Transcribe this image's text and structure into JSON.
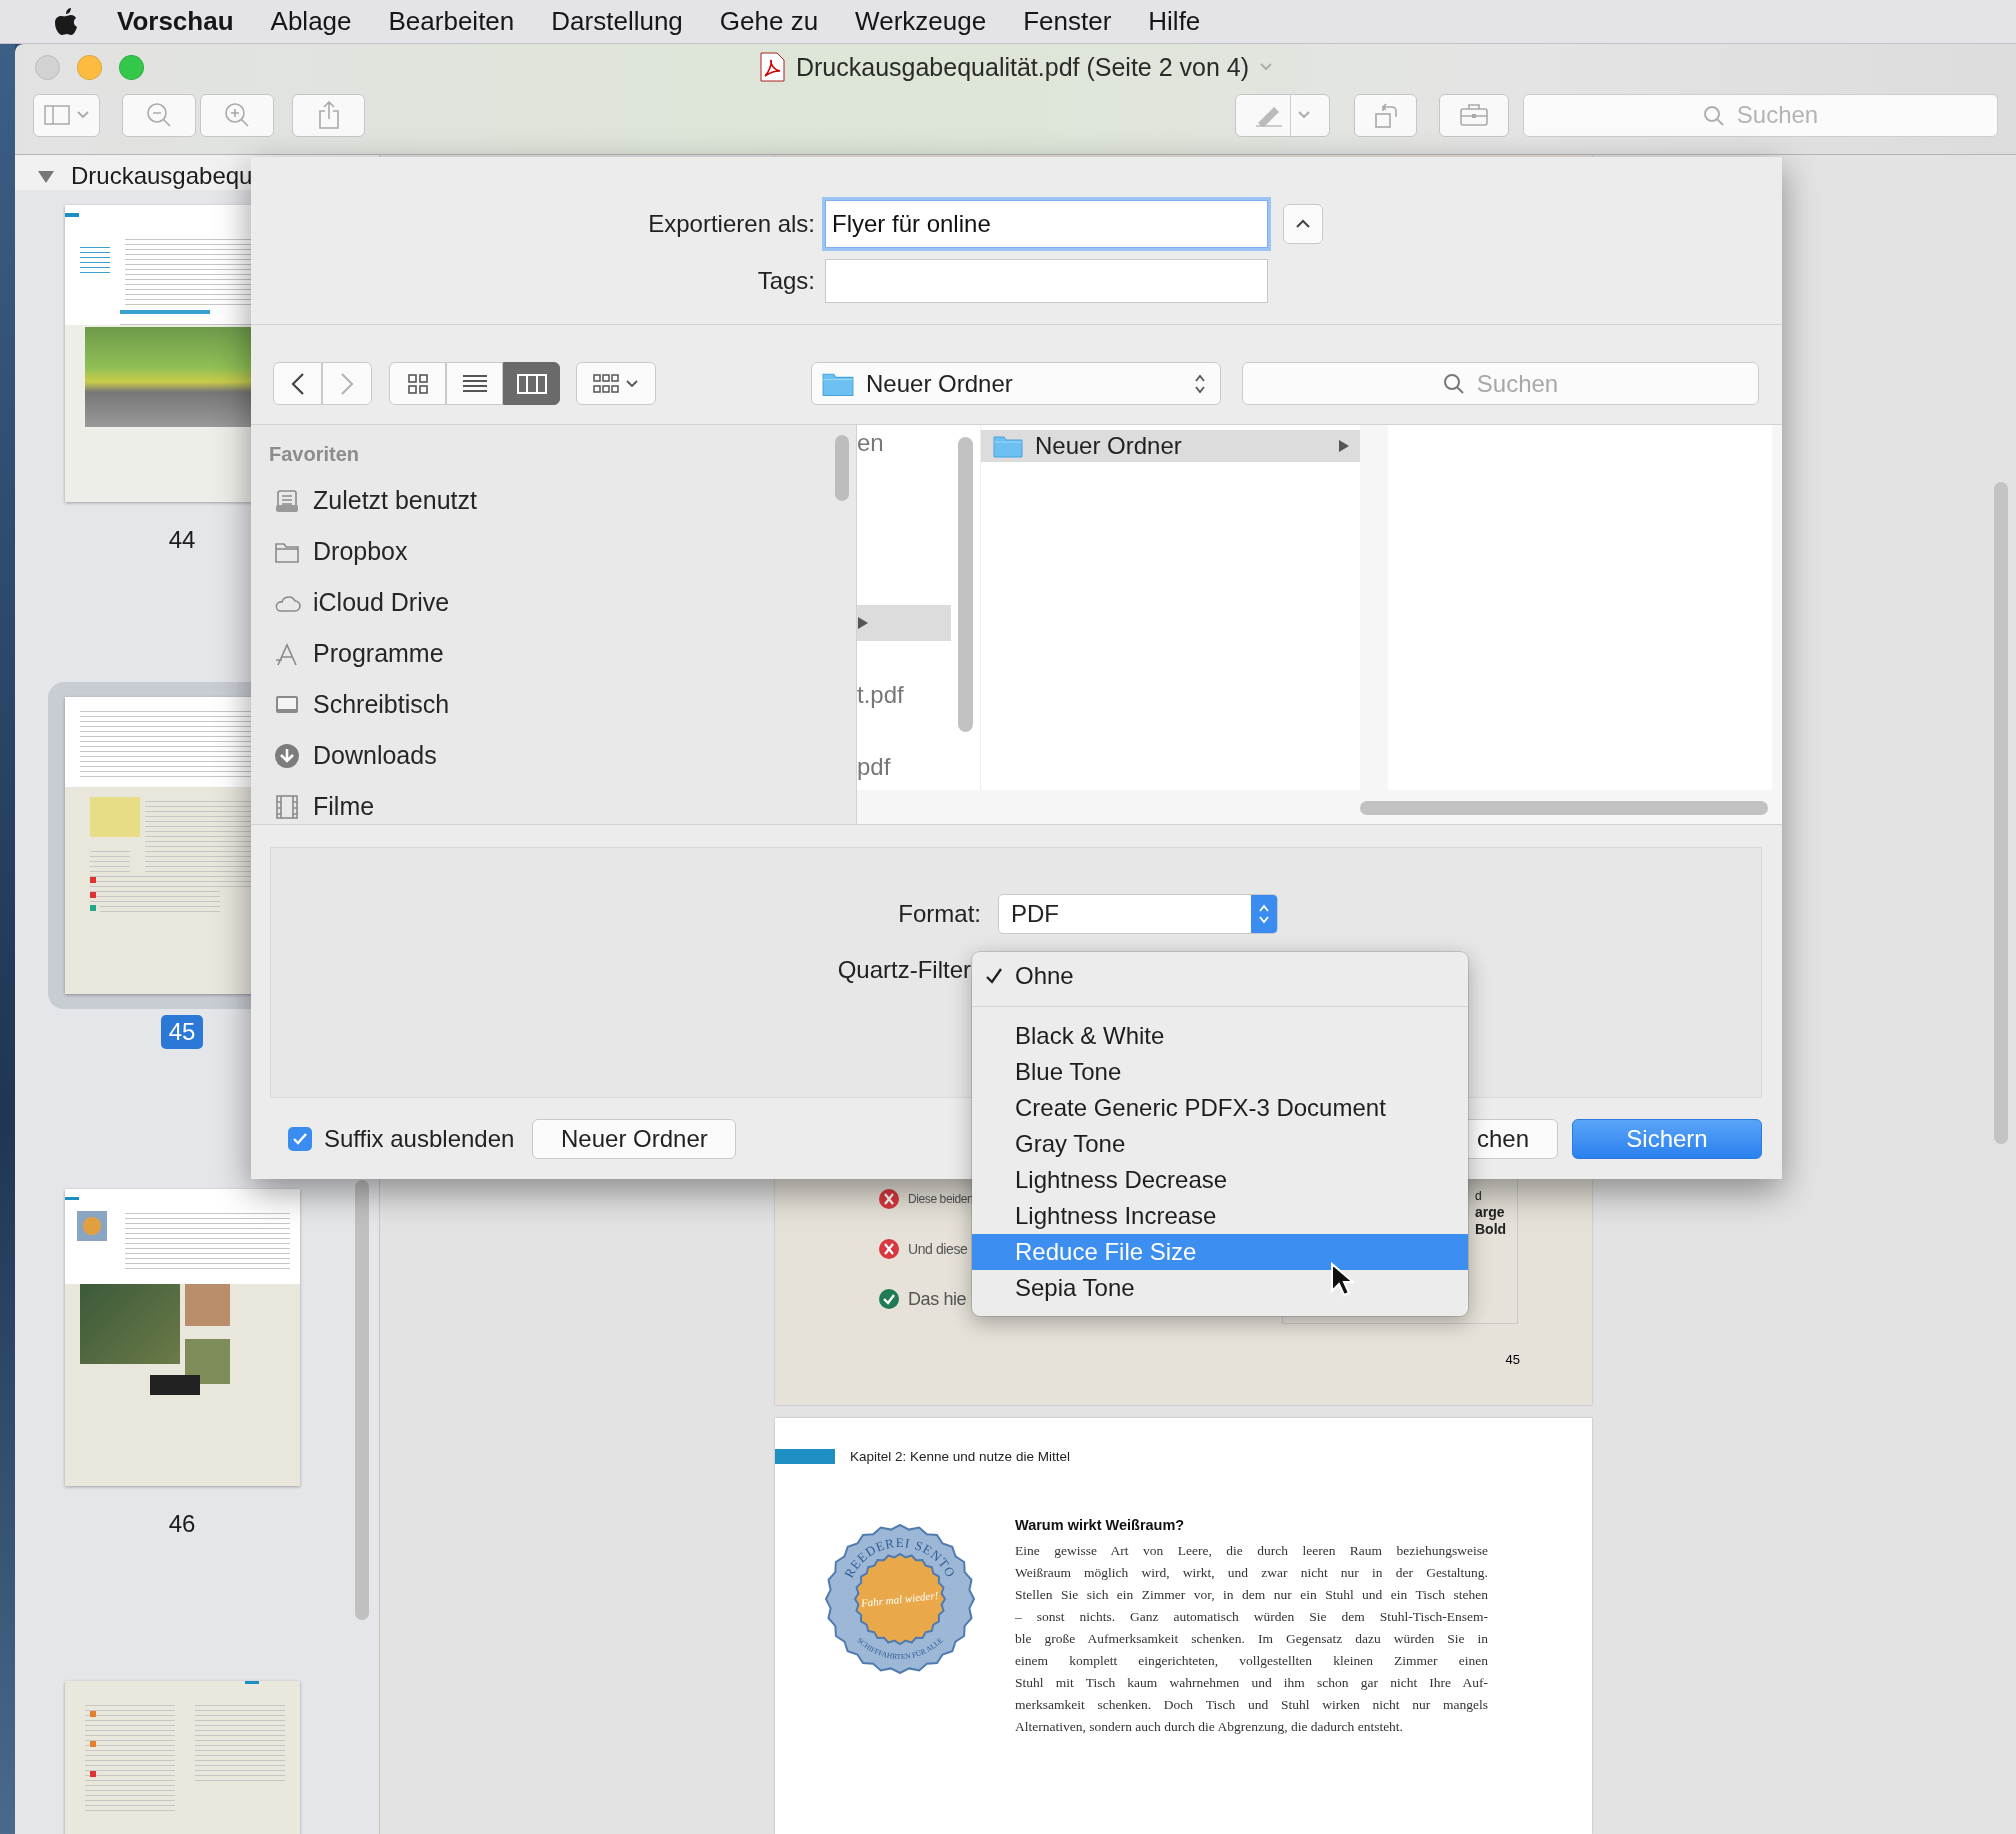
{
  "menubar": {
    "app_name": "Vorschau",
    "items": [
      "Ablage",
      "Bearbeiten",
      "Darstellung",
      "Gehe zu",
      "Werkzeuge",
      "Fenster",
      "Hilfe"
    ]
  },
  "window": {
    "title": "Druckausgabequalität.pdf (Seite 2 von 4)",
    "search_placeholder": "Suchen",
    "buttons": [
      {
        "kind": "close",
        "disabled": true
      },
      {
        "kind": "minimize",
        "disabled": false
      },
      {
        "kind": "zoom",
        "disabled": false
      }
    ]
  },
  "sidebar": {
    "title": "Druckausgabequ",
    "thumbnails": [
      {
        "kind": "text-photo",
        "label": "44",
        "selected": false
      },
      {
        "kind": "text-boxes",
        "label": "45",
        "selected": true
      },
      {
        "kind": "photos",
        "label": "46",
        "selected": false
      },
      {
        "kind": "list",
        "selected": false
      }
    ]
  },
  "document": {
    "page_45": {
      "notes": [
        {
          "kind": "cross",
          "text": "Diese beiden"
        },
        {
          "kind": "cross",
          "text": "Und diese"
        },
        {
          "kind": "check",
          "text": "Das hie"
        }
      ],
      "box_lines": [
        "d",
        "arge",
        "Bold"
      ],
      "page_number": "45"
    },
    "page_46": {
      "header": "Kapitel 2: Kenne und nutze die Mittel",
      "badge": {
        "top": "REEDEREI SENTO",
        "middle": "Fahr mal wieder!",
        "bottom": "SCHIFFFAHRTEN FÜR ALLE"
      },
      "heading": "Warum wirkt Weißraum?",
      "lines": [
        "Eine gewisse Art von Leere, die durch leeren Raum beziehungsweise",
        "Weißraum möglich wird, wirkt, und zwar nicht nur in der Gestaltung.",
        "Stellen Sie sich ein Zimmer vor, in dem nur ein Stuhl und ein Tisch stehen",
        "– sonst nichts. Ganz automatisch würden Sie dem Stuhl-Tisch-Ensem-",
        "ble große Aufmerksamkeit schenken. Im Gegensatz dazu würden Sie in",
        "einem komplett eingerichteten, vollgestellten kleinen Zimmer einen",
        "Stuhl mit Tisch kaum wahrnehmen und ihm schon gar nicht Ihre Auf-",
        "merksamkeit schenken. Doch Tisch und Stuhl wirken nicht nur mangels",
        "Alternativen, sondern auch durch die Abgrenzung, die dadurch entsteht."
      ]
    }
  },
  "dialog": {
    "export_label": "Exportieren als:",
    "filename": "Flyer für online",
    "tags_label": "Tags:",
    "view_modes": [
      {
        "kind": "icons",
        "selected": false
      },
      {
        "kind": "list",
        "selected": false
      },
      {
        "kind": "columns",
        "selected": true
      }
    ],
    "location": "Neuer Ordner",
    "search_placeholder": "Suchen",
    "favorites_heading": "Favoriten",
    "favorites": [
      {
        "kind": "recents",
        "label": "Zuletzt benutzt"
      },
      {
        "kind": "folder",
        "label": "Dropbox"
      },
      {
        "kind": "cloud",
        "label": "iCloud Drive"
      },
      {
        "kind": "apps",
        "label": "Programme"
      },
      {
        "kind": "desktop",
        "label": "Schreibtisch"
      },
      {
        "kind": "downloads",
        "label": "Downloads"
      },
      {
        "kind": "film",
        "label": "Filme"
      }
    ],
    "column_1": [
      {
        "label": "en",
        "selected": false
      },
      {
        "selected": true
      },
      {
        "label": "t.pdf",
        "selected": false
      },
      {
        "label": "pdf",
        "selected": false
      }
    ],
    "column_2": [
      {
        "label": "Neuer Ordner",
        "selected": true
      }
    ],
    "format_label": "Format:",
    "format_value": "PDF",
    "quartz_label": "Quartz-Filter",
    "quartz_menu": [
      {
        "kind": "option",
        "label": "Ohne",
        "checked": true,
        "selected": false
      },
      {
        "kind": "separator"
      },
      {
        "kind": "option",
        "label": "Black & White",
        "checked": false,
        "selected": false
      },
      {
        "kind": "option",
        "label": "Blue Tone",
        "checked": false,
        "selected": false
      },
      {
        "kind": "option",
        "label": "Create Generic PDFX-3 Document",
        "checked": false,
        "selected": false
      },
      {
        "kind": "option",
        "label": "Gray Tone",
        "checked": false,
        "selected": false
      },
      {
        "kind": "option",
        "label": "Lightness Decrease",
        "checked": false,
        "selected": false
      },
      {
        "kind": "option",
        "label": "Lightness Increase",
        "checked": false,
        "selected": false
      },
      {
        "kind": "option",
        "label": "Reduce File Size",
        "checked": false,
        "selected": true
      },
      {
        "kind": "option",
        "label": "Sepia Tone",
        "checked": false,
        "selected": false
      }
    ],
    "suffix": {
      "label": "Suffix ausblenden",
      "checked": true
    },
    "new_folder_button": "Neuer Ordner",
    "cancel_button": "chen",
    "save_button": "Sichern"
  }
}
